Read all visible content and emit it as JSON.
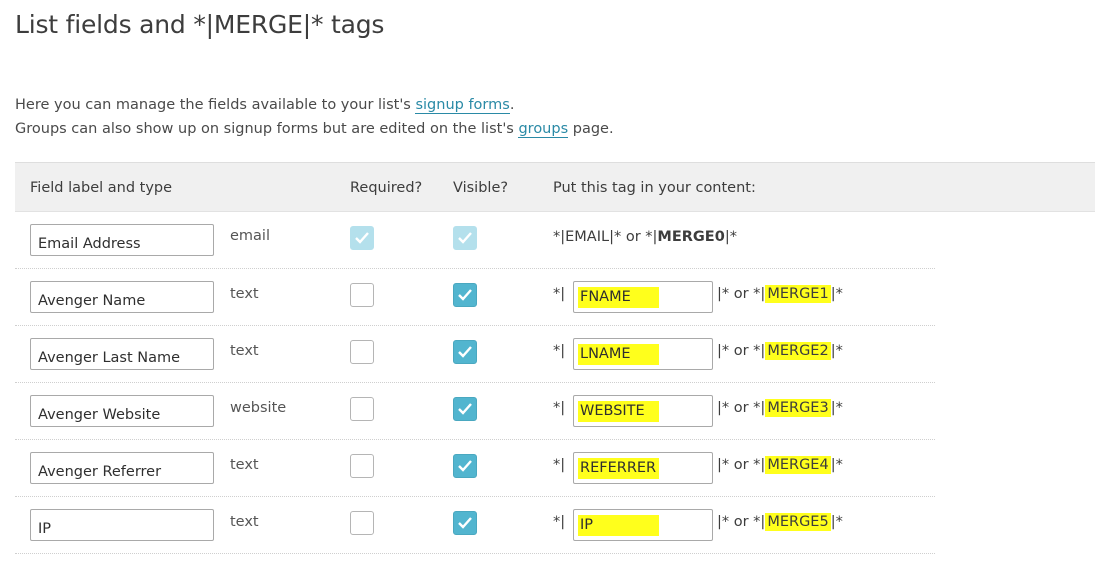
{
  "page": {
    "title": "List fields and *|MERGE|* tags",
    "intro_line1_before": "Here you can manage the fields available to your list's ",
    "intro_line1_link": "signup forms",
    "intro_line1_after": ".",
    "intro_line2_before": "Groups can also show up on signup forms but are edited on the list's ",
    "intro_line2_link": "groups",
    "intro_line2_after": " page."
  },
  "table": {
    "headers": {
      "field": "Field label and type",
      "required": "Required?",
      "visible": "Visible?",
      "tag": "Put this tag in your content:"
    },
    "email_row": {
      "label": "Email Address",
      "type": "email",
      "tag_prefix": "*|EMAIL|* or *|",
      "tag_merge": "MERGE0",
      "tag_suffix": "|*"
    },
    "rows": [
      {
        "label": "Avenger Name",
        "type": "text",
        "tag": "FNAME",
        "merge": "MERGE1"
      },
      {
        "label": "Avenger Last Name",
        "type": "text",
        "tag": "LNAME",
        "merge": "MERGE2"
      },
      {
        "label": "Avenger Website",
        "type": "website",
        "tag": "WEBSITE",
        "merge": "MERGE3"
      },
      {
        "label": "Avenger Referrer",
        "type": "text",
        "tag": "REFERRER",
        "merge": "MERGE4"
      },
      {
        "label": "IP",
        "type": "text",
        "tag": "IP",
        "merge": "MERGE5"
      }
    ],
    "tag_open": "*|",
    "tag_middle": "|* or *|",
    "tag_close": "|*"
  },
  "icons": {
    "checkmark": "checkmark-icon"
  },
  "colors": {
    "checkbox_checked": "#52b5cf",
    "checkbox_disabled": "#b4e0ec",
    "highlight": "#ffff1c",
    "link": "#2a8aa6"
  }
}
